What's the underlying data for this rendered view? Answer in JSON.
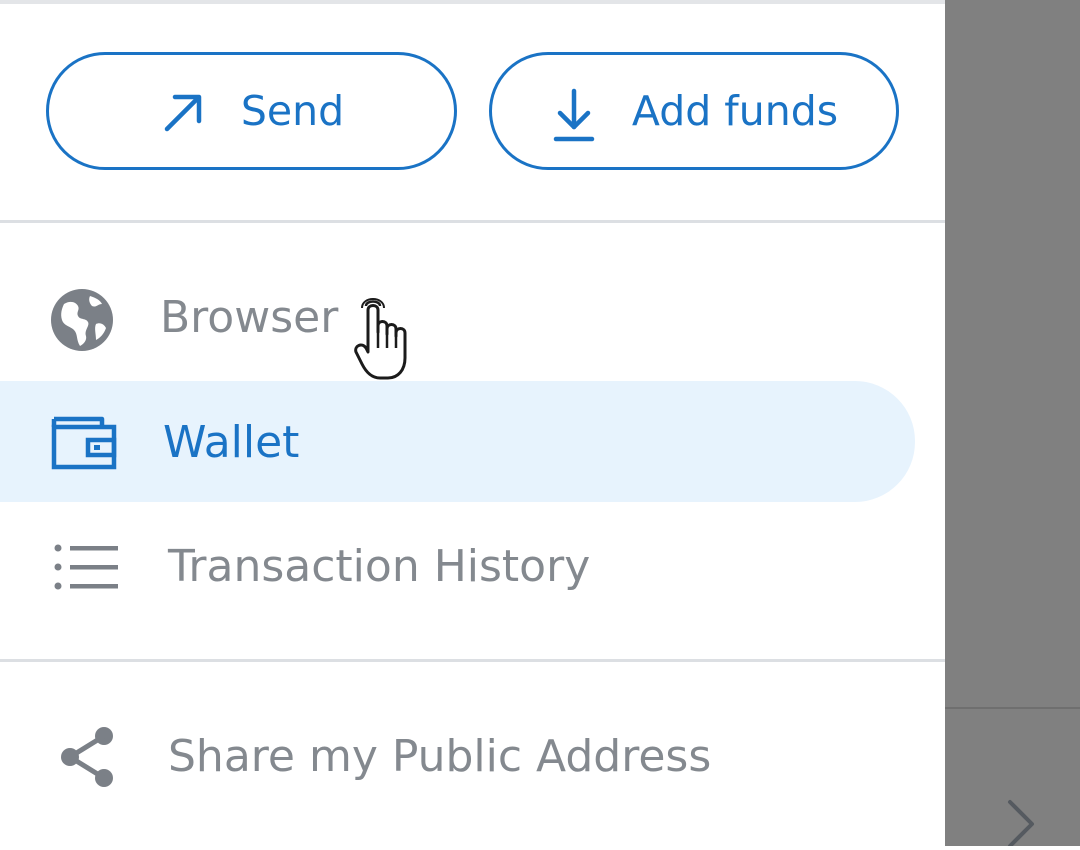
{
  "actions": {
    "send_label": "Send",
    "add_funds_label": "Add funds"
  },
  "nav": {
    "items": [
      {
        "label": "Browser",
        "icon": "globe-icon",
        "active": false
      },
      {
        "label": "Wallet",
        "icon": "wallet-icon",
        "active": true
      },
      {
        "label": "Transaction History",
        "icon": "list-icon",
        "active": false
      }
    ],
    "secondary": [
      {
        "label": "Share my Public Address",
        "icon": "share-icon"
      }
    ]
  },
  "colors": {
    "accent": "#1a73c5",
    "muted_text": "#84898f",
    "selected_bg": "#e7f3fd",
    "overlay": "#808080"
  },
  "overlay": {
    "icon": "chevron-right-icon"
  }
}
